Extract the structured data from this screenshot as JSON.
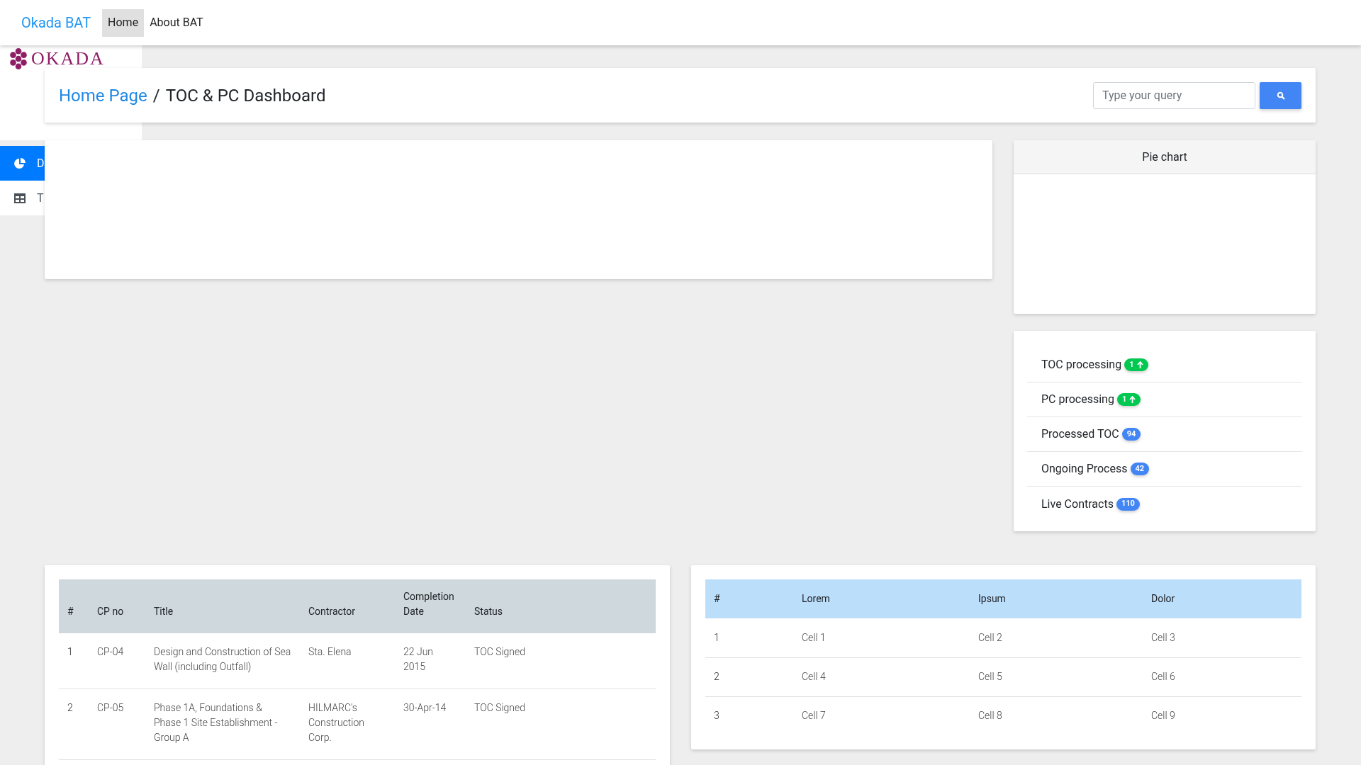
{
  "navbar": {
    "brand": "Okada BAT",
    "items": [
      {
        "label": "Home",
        "selected": true
      },
      {
        "label": "About BAT",
        "selected": false
      }
    ]
  },
  "sidebar": {
    "logo": "OKADA",
    "items": [
      {
        "label": "D",
        "kind": "pie",
        "selected": true
      },
      {
        "label": "T",
        "kind": "table",
        "selected": false
      }
    ]
  },
  "header": {
    "breadcrumb_link": "Home Page",
    "breadcrumb_separator": "/",
    "breadcrumb_current": "TOC & PC Dashboard",
    "search": {
      "placeholder": "Type your query"
    }
  },
  "pie_card": {
    "title": "Pie chart"
  },
  "stats": [
    {
      "label": "TOC processing",
      "count": "1",
      "kind": "rising",
      "color": "#00c851"
    },
    {
      "label": "PC processing",
      "count": "1",
      "kind": "rising",
      "color": "#00c851"
    },
    {
      "label": "Processed TOC",
      "count": "94",
      "kind": "plain",
      "color": "#4285f4"
    },
    {
      "label": "Ongoing Process",
      "count": "42",
      "kind": "plain",
      "color": "#4285f4"
    },
    {
      "label": "Live Contracts",
      "count": "110",
      "kind": "plain",
      "color": "#4285f4"
    }
  ],
  "contracts_table": {
    "columns": [
      "#",
      "CP no",
      "Title",
      "Contractor",
      "Completion Date",
      "Status"
    ],
    "rows": [
      [
        "1",
        "CP-04",
        "Design and Construction of Sea Wall (including Outfall)",
        "Sta. Elena",
        "22 Jun 2015",
        "TOC Signed"
      ],
      [
        "2",
        "CP-05",
        "Phase 1A, Foundations & Phase 1 Site Establishment - Group A",
        "HILMARC's Construction Corp.",
        "30-Apr-14",
        "TOC Signed"
      ]
    ]
  },
  "sample_table": {
    "columns": [
      "#",
      "Lorem",
      "Ipsum",
      "Dolor"
    ],
    "rows": [
      [
        "1",
        "Cell 1",
        "Cell 2",
        "Cell 3"
      ],
      [
        "2",
        "Cell 4",
        "Cell 5",
        "Cell 6"
      ],
      [
        "3",
        "Cell 7",
        "Cell 8",
        "Cell 9"
      ]
    ]
  }
}
